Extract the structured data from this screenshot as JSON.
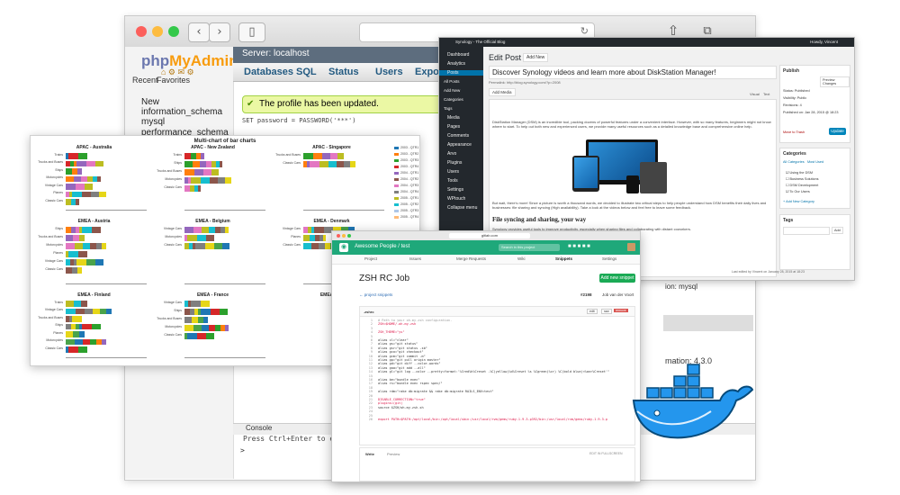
{
  "phpmyadmin": {
    "logo_php": "php",
    "logo_myadmin": "MyAdmin",
    "nav_links": [
      "Recent",
      "Favorites"
    ],
    "tree": [
      "New",
      "information_schema",
      "mysql",
      "performance_schema"
    ],
    "server": "Server: localhost",
    "tabs": [
      "Databases",
      "SQL",
      "Status",
      "Users",
      "Export"
    ],
    "success": "The profile has been updated.",
    "sql": "SET password = PASSWORD('***')",
    "console_title": "Console",
    "console_text": "Press Ctrl+Enter to execute",
    "console_prompt": ">",
    "right_info": [
      "mation: 4.3.0",
      "ion: mysql"
    ]
  },
  "charts": {
    "title": "Multi-chart of bar charts",
    "legend": [
      "2003 - QTR1",
      "2003 - QTR2",
      "2003 - QTR3",
      "2003 - QTR4",
      "2004 - QTR1",
      "2004 - QTR2",
      "2004 - QTR3",
      "2004 - QTR4",
      "2005 - QTR1",
      "2005 - QTR2",
      "2005 - QTR3",
      "2005 - QTR4"
    ],
    "legend_colors": [
      "#1f77b4",
      "#ff7f0e",
      "#2ca02c",
      "#d62728",
      "#9467bd",
      "#8c564b",
      "#e377c2",
      "#7f7f7f",
      "#bcbd22",
      "#17becf",
      "#aec7e8",
      "#ffbb78"
    ],
    "panels": [
      {
        "title": "APAC - Australia",
        "cats": [
          "Trains",
          "Trucks and Buses",
          "Ships",
          "Motorcycles",
          "Vintage Cars",
          "Planes",
          "Classic Cars"
        ]
      },
      {
        "title": "APAC - New Zealand",
        "cats": [
          "Trains",
          "Ships",
          "Trucks and Buses",
          "Motorcycles",
          "Classic Cars"
        ]
      },
      {
        "title": "APAC - Singapore",
        "cats": [
          "Trucks and Buses",
          "Classic Cars"
        ]
      },
      {
        "title": "EMEA - Austria",
        "cats": [
          "Ships",
          "Trucks and Buses",
          "Motorcycles",
          "Planes",
          "Vintage Cars",
          "Classic Cars"
        ]
      },
      {
        "title": "EMEA - Belgium",
        "cats": [
          "Vintage Cars",
          "Motorcycles",
          "Classic Cars"
        ]
      },
      {
        "title": "EMEA - Denmark",
        "cats": [
          "Vintage Cars",
          "Planes",
          "Classic Cars"
        ]
      },
      {
        "title": "EMEA - Finland",
        "cats": [
          "Trains",
          "Vintage Cars",
          "Trucks and Buses",
          "Ships",
          "Planes",
          "Motorcycles",
          "Classic Cars"
        ]
      },
      {
        "title": "EMEA - France",
        "cats": [
          "Vintage Cars",
          "Ships",
          "Trucks and Buses",
          "Motorcycles",
          "Classic Cars"
        ]
      },
      {
        "title": "EMEA - Ge",
        "cats": []
      }
    ]
  },
  "wordpress": {
    "topbar_title": "Synology - The Official Blog",
    "topbar_right": "Howdy, Vincent",
    "menu": [
      "Dashboard",
      "Analytics",
      "Posts",
      "All Posts",
      "Add New",
      "Categories",
      "Tags",
      "Media",
      "Pages",
      "Comments",
      "Appearance",
      "Arvo",
      "Plugins",
      "Users",
      "Tools",
      "Settings",
      "WPtouch",
      "Collapse menu"
    ],
    "heading": "Edit Post",
    "add_new": "Add New",
    "post_title": "Discover Synology videos and learn more about DiskStation Manager!",
    "permalink": "Permalink: http://blog.synology.com/?p=2008",
    "add_media": "Add Media",
    "tabs": [
      "Visual",
      "Text"
    ],
    "body1": "DiskStation Manager (DSM) is an incredible tool, packing dozens of powerful features under a convenient interface. However, with so many features, beginners might not know where to start. To help out both new and experienced users, we provide many useful resources such as a detailed knowledge base and comprehensive online help.",
    "body2": "But wait, there's more! Since a picture is worth a thousand words, we decided to illustrate two critical steps to help people understand how DSM benefits their daily lives and businesses: file sharing and syncing (High availability). Take a look at the videos below and feel free to leave some feedback.",
    "h2": "File syncing and sharing, your way",
    "body3": "Synology provides useful tools to improve productivity, especially when sharing files and collaborating with distant coworkers.",
    "publish": "Publish",
    "save_draft": "Save Draft",
    "preview": "Preview Changes",
    "status": "Status: Published",
    "visibility": "Visibility: Public",
    "revisions": "Revisions: 4",
    "published_on": "Published on: Jan 28, 2015 @ 18:23",
    "trash": "Move to Trash",
    "update": "Update",
    "categories": "Categories",
    "cat_tabs": [
      "All Categories",
      "Most Used"
    ],
    "cat_items": [
      "Using the DSM",
      "Business Solutions",
      "DSM Development",
      "To Our Users"
    ],
    "add_cat": "+ Add New Category",
    "tags": "Tags",
    "tag_add": "Add",
    "last_edited": "Last edited by Vincent on January 28, 2015 at 18:23"
  },
  "gitlab": {
    "url": "gitlab.com",
    "project": "Awesome People / test",
    "search_placeholder": "Search in this project",
    "tabs": [
      "Project",
      "Issues",
      "Merge Requests",
      "Wiki",
      "Snippets",
      "Settings"
    ],
    "title": "ZSH RC Job",
    "new_snippet": "Add new snippet",
    "back_link": "← project snippets",
    "snippet_id": "#2198",
    "author": "Job van der Voort",
    "file_name": ".zshrc",
    "file_buttons": [
      "edit",
      "raw",
      "remove"
    ],
    "code": [
      "# Path to your oh-my-zsh configuration.",
      "ZSH=$HOME/.oh-my-zsh",
      "",
      "ZSH_THEME=\"ys\"",
      "",
      "alias cl=\"clear\"",
      "alias gs=\"git status\"",
      "alias gsr=\"git status -sb\"",
      "alias gco=\"git checkout\"",
      "alias gcm=\"git commit -m\"",
      "alias gp=\"git pull origin master\"",
      "alias gd=\"git diff --color-words\"",
      "alias gaa=\"git add --all\"",
      "alias gl=\"git log --color --pretty=format:'%Cred%h%Creset -%C(yellow)%d%Creset %s %Cgreen(%cr) %C(bold blue)<%an>%Creset'\"",
      "",
      "alias be=\"bundle exec\"",
      "alias rs=\"bundle exec rspec spec/\"",
      "",
      "alias rdm=\"rake db:migrate && rake db:migrate RAILS_ENV=test\"",
      "",
      "DISABLE_CORRECTION=\"true\"",
      "plugins=(git)",
      "source $ZSH/oh-my-zsh.sh",
      "",
      "",
      "export PATH=$PATH:/opt/local/bin:/opt/local/sbin:/usr/local/rvm/gems/ruby-1.9.3-p392/bin:/usr/local/rvm/gems/ruby-1.9.3-p"
    ],
    "comment_tabs": [
      "Write",
      "Preview"
    ],
    "fullscreen": "EDIT IN FULLSCREEN"
  },
  "docker": {
    "whale_color": "#2496ed",
    "outline_color": "#064a7a"
  }
}
